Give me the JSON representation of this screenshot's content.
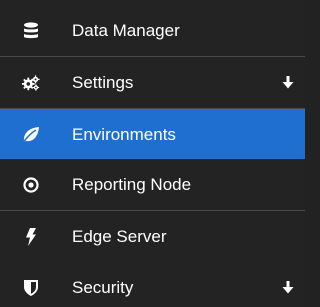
{
  "sidebar": {
    "items": [
      {
        "label": "Data Manager",
        "icon": "database-icon",
        "has_submenu": false
      },
      {
        "label": "Settings",
        "icon": "cogs-icon",
        "has_submenu": true
      },
      {
        "label": "Environments",
        "icon": "leaf-icon",
        "has_submenu": false,
        "active": true
      },
      {
        "label": "Reporting Node",
        "icon": "target-icon",
        "has_submenu": false
      },
      {
        "label": "Edge Server",
        "icon": "lightning-icon",
        "has_submenu": false
      },
      {
        "label": "Security",
        "icon": "shield-icon",
        "has_submenu": true
      }
    ]
  },
  "colors": {
    "background": "#232323",
    "active": "#1f6fd1",
    "divider": "#4a4a4a",
    "text": "#ffffff"
  }
}
